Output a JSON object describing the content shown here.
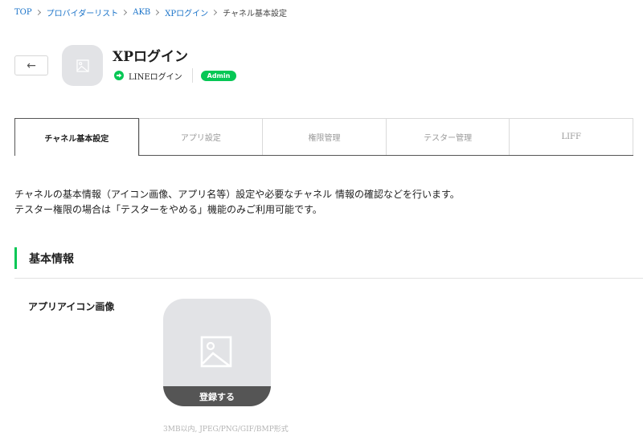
{
  "breadcrumb": {
    "items": [
      {
        "label": "TOP"
      },
      {
        "label": "プロバイダーリスト"
      },
      {
        "label": "AKB"
      },
      {
        "label": "XPログイン"
      }
    ],
    "current": "チャネル基本設定"
  },
  "header": {
    "back_icon": "arrow-left-icon",
    "avatar_icon": "image-placeholder-icon",
    "title": "XPログイン",
    "login_type_icon": "line-arrow-icon",
    "login_type": "LINEログイン",
    "role_badge": "Admin"
  },
  "tabs": [
    {
      "label": "チャネル基本設定",
      "active": true
    },
    {
      "label": "アプリ設定",
      "active": false
    },
    {
      "label": "権限管理",
      "active": false
    },
    {
      "label": "テスター管理",
      "active": false
    },
    {
      "label": "LIFF",
      "active": false
    }
  ],
  "description": {
    "line1": "チャネルの基本情報（アイコン画像、アプリ名等）設定や必要なチャネル 情報の確認などを行います。",
    "line2": "テスター権限の場合は「テスターをやめる」機能のみご利用可能です。"
  },
  "section": {
    "title": "基本情報"
  },
  "app_icon_field": {
    "label": "アプリアイコン画像",
    "placeholder_icon": "image-placeholder-icon",
    "upload_label": "登録する",
    "hint": "3MB以内, JPEG/PNG/GIF/BMP形式"
  },
  "colors": {
    "accent": "#06c755",
    "link": "#1a73c9",
    "placeholder_bg": "#e2e3e6",
    "upload_bar": "#555555"
  }
}
